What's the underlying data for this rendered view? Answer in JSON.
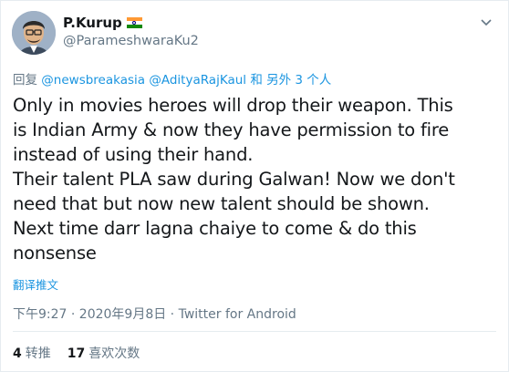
{
  "user": {
    "display_name": "P.Kurup",
    "handle": "@ParameshwaraKu2",
    "flag_colors": [
      "#ff9933",
      "#ffffff",
      "#138808"
    ]
  },
  "reply": {
    "prefix": "回复",
    "mention1": "@newsbreakasia",
    "mention2": "@AdityaRajKaul",
    "suffix_and": "和",
    "suffix_others": "另外 3 个人"
  },
  "tweet": {
    "text": "Only in movies heroes will drop their weapon. This\nis Indian Army & now they have permission to fire\ninstead of using their hand.\nTheir talent PLA saw during Galwan! Now we don't\nneed that but now new talent should be shown.\nNext time darr lagna chaiye to come & do this\nnonsense"
  },
  "translate_label": "翻译推文",
  "meta": "下午9:27 · 2020年9月8日 · Twitter for Android",
  "stats": {
    "retweets_count": "4",
    "retweets_label": "转推",
    "likes_count": "17",
    "likes_label": "喜欢次数"
  },
  "icons": {
    "caret": "chevron-down-icon"
  }
}
